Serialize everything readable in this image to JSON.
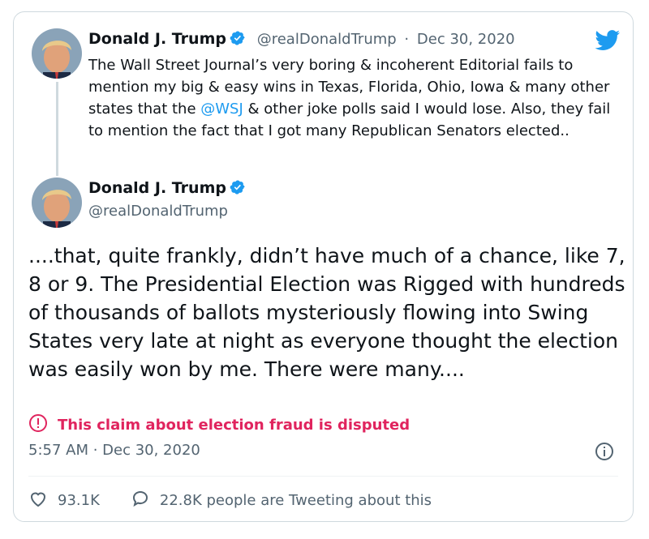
{
  "tweet1": {
    "name": "Donald J. Trump",
    "handle": "@realDonaldTrump",
    "separator": "·",
    "date": "Dec 30, 2020",
    "text_part1": "The Wall Street Journal’s very boring & incoherent Editorial fails to mention my big & easy wins in Texas, Florida, Ohio, Iowa & many other states that the ",
    "mention": "@WSJ",
    "text_part2": " & other joke polls said I would lose. Also, they fail to mention the fact that I got many Republican Senators elected.."
  },
  "tweet2": {
    "name": "Donald J. Trump",
    "handle": "@realDonaldTrump",
    "text": "....that, quite frankly, didn’t have much of a chance, like 7, 8 or 9. The Presidential Election was Rigged with hundreds of thousands of ballots mysteriously flowing into Swing States very late at night as everyone thought the election was easily won by me. There were many....",
    "dispute_label": "This claim about election fraud is disputed",
    "timestamp": "5:57 AM · Dec 30, 2020"
  },
  "actions": {
    "likes": "93.1K",
    "tweeting": "22.8K people are Tweeting about this"
  },
  "icons": {
    "twitter": "twitter-bird-icon",
    "verified": "verified-badge-icon",
    "dispute": "alert-circle-icon",
    "info": "info-icon",
    "heart": "heart-icon",
    "reply": "speech-bubble-icon"
  },
  "colors": {
    "accent": "#1d9bf0",
    "dispute": "#e0245e",
    "muted": "#536471",
    "border": "#cfd9de"
  }
}
